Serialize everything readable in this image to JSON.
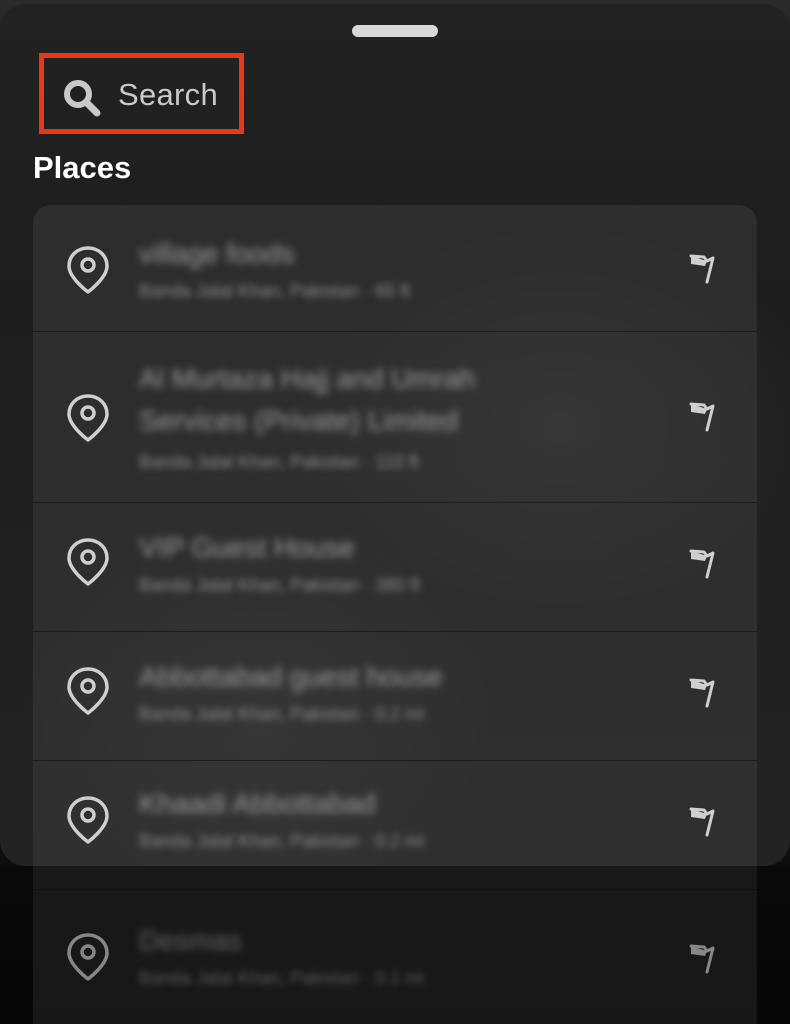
{
  "search": {
    "label": "Search",
    "icon": "search-icon"
  },
  "section_title": "Places",
  "places": [
    {
      "title": "village foods",
      "subtitle": "Banda Jalal Khan, Pakistan · 65 ft",
      "icon": "map-pin-icon",
      "action_icon": "flag-icon"
    },
    {
      "title": "Al Murtaza Hajj and Umrah Services (Private) Limited",
      "subtitle": "Banda Jalal Khan, Pakistan · 110 ft",
      "icon": "map-pin-icon",
      "action_icon": "flag-icon"
    },
    {
      "title": "VIP Guest House",
      "subtitle": "Banda Jalal Khan, Pakistan · 380 ft",
      "icon": "map-pin-icon",
      "action_icon": "flag-icon"
    },
    {
      "title": "Abbottabad guest house",
      "subtitle": "Banda Jalal Khan, Pakistan · 0.2 mi",
      "icon": "map-pin-icon",
      "action_icon": "flag-icon"
    },
    {
      "title": "Khaadi Abbottabad",
      "subtitle": "Banda Jalal Khan, Pakistan · 0.2 mi",
      "icon": "map-pin-icon",
      "action_icon": "flag-icon"
    },
    {
      "title": "Desmas",
      "subtitle": "Banda Jalal Khan, Pakistan · 0.1 mi",
      "icon": "map-pin-icon",
      "action_icon": "flag-icon"
    }
  ],
  "colors": {
    "highlight_border": "#e8381c",
    "title_text": "#ffffff",
    "search_text": "#c9c9c9",
    "icon_stroke": "#cfcfcf"
  }
}
